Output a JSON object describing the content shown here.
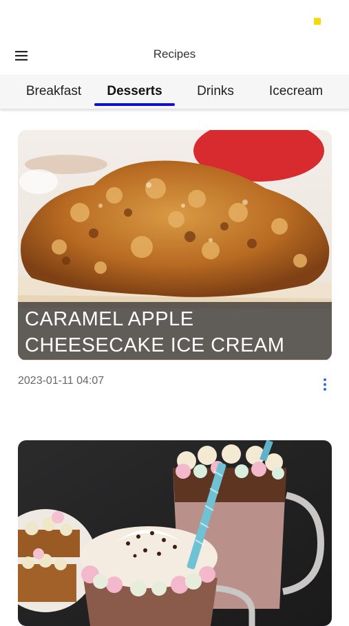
{
  "app": {
    "title": "Recipes"
  },
  "tabs": [
    {
      "label": "Breakfast",
      "active": false
    },
    {
      "label": "Desserts",
      "active": true
    },
    {
      "label": "Drinks",
      "active": false
    },
    {
      "label": "Icecream",
      "active": false
    }
  ],
  "recipes": [
    {
      "title": "CARAMEL APPLE CHEESECAKE ICE CREAM",
      "timestamp": "2023-01-11 04:07",
      "image": "caramel-apple-cheesecake-photo"
    },
    {
      "title": "",
      "timestamp": "",
      "image": "hot-chocolate-marshmallow-photo"
    }
  ],
  "icons": {
    "menu": "hamburger-menu-icon",
    "more": "more-vertical-icon"
  },
  "colors": {
    "tab_indicator": "#1010cc",
    "more_icon": "#2b6fd6",
    "status_dot": "#f5d90a"
  }
}
